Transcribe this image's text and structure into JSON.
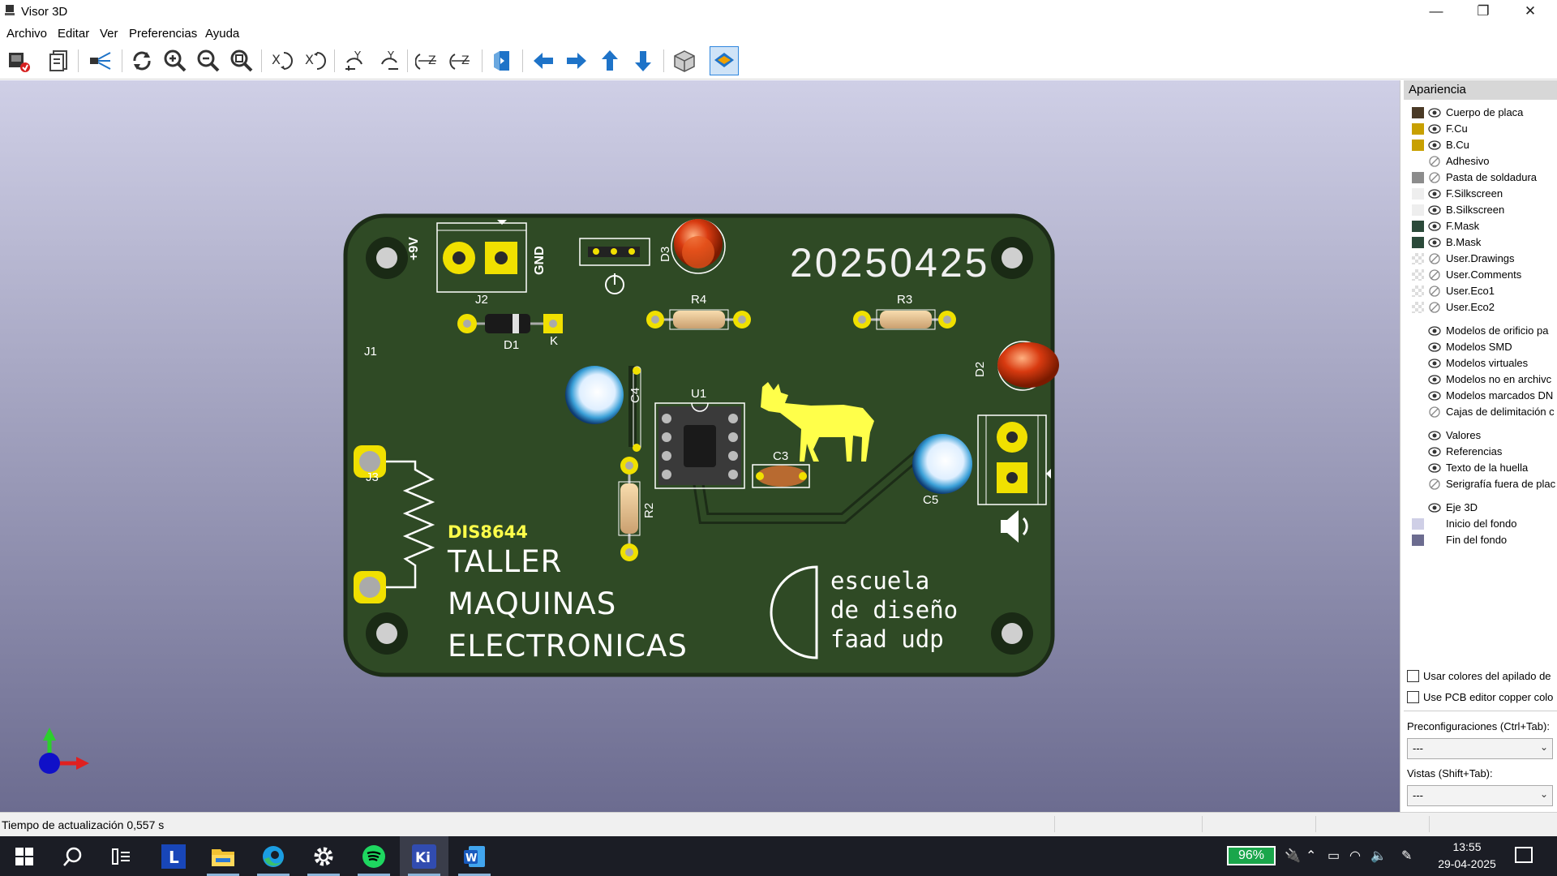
{
  "window": {
    "title": "Visor 3D",
    "minimize": "—",
    "restore": "❐",
    "close": "✕"
  },
  "menu": [
    "Archivo",
    "Editar",
    "Ver",
    "Preferencias",
    "Ayuda"
  ],
  "toolbar": [
    "render-raytrace-icon",
    "copy-image-icon",
    "camera-icon",
    "reload-icon",
    "zoom-in-icon",
    "zoom-out-icon",
    "zoom-fit-icon",
    "rotate-x-cw-icon",
    "rotate-x-ccw-icon",
    "rotate-y-cw-icon",
    "rotate-y-ccw-icon",
    "rotate-z-cw-icon",
    "rotate-z-ccw-icon",
    "flip-board-icon",
    "arrow-left-icon",
    "arrow-right-icon",
    "arrow-up-icon",
    "arrow-down-icon",
    "ortho-view-icon",
    "layers-icon"
  ],
  "board": {
    "silk": {
      "date": "20250425",
      "plus9v": "+9V",
      "gnd": "GND",
      "j2": "J2",
      "d1": "D1",
      "k": "K",
      "d3": "D3",
      "r4": "R4",
      "r3": "R3",
      "j1": "J1",
      "j3": "J3",
      "c4": "C4",
      "u1": "U1",
      "c3": "C3",
      "d2": "D2",
      "c5": "C5",
      "r2": "R2",
      "code": "DIS8644",
      "taller1": "TALLER",
      "taller2": "MAQUINAS",
      "taller3": "ELECTRONICAS",
      "esc1": "escuela",
      "esc2": "de diseño",
      "esc3": "faad udp"
    },
    "colors": {
      "pcb": "#2f4a25",
      "pad": "#f0e000",
      "silk": "#ffffff",
      "deer": "#ffff4a"
    }
  },
  "appearance": {
    "title": "Apariencia",
    "layers": [
      {
        "name": "Cuerpo de placa",
        "color": "#4a3a26",
        "visible": true
      },
      {
        "name": "F.Cu",
        "color": "#c8a000",
        "visible": true
      },
      {
        "name": "B.Cu",
        "color": "#c8a000",
        "visible": true
      },
      {
        "name": "Adhesivo",
        "color": "",
        "visible": false
      },
      {
        "name": "Pasta de soldadura",
        "color": "#8c8c8c",
        "visible": false
      },
      {
        "name": "F.Silkscreen",
        "color": "#eeeeee",
        "visible": true
      },
      {
        "name": "B.Silkscreen",
        "color": "#eeeeee",
        "visible": true
      },
      {
        "name": "F.Mask",
        "color": "#2b4a3a",
        "visible": true
      },
      {
        "name": "B.Mask",
        "color": "#2b4a3a",
        "visible": true
      },
      {
        "name": "User.Drawings",
        "color": "checker",
        "visible": false
      },
      {
        "name": "User.Comments",
        "color": "checker",
        "visible": false
      },
      {
        "name": "User.Eco1",
        "color": "checker",
        "visible": false
      },
      {
        "name": "User.Eco2",
        "color": "checker",
        "visible": false
      }
    ],
    "models": [
      {
        "name": "Modelos de orificio pa",
        "visible": true
      },
      {
        "name": "Modelos SMD",
        "visible": true
      },
      {
        "name": "Modelos virtuales",
        "visible": true
      },
      {
        "name": "Modelos no en archivc",
        "visible": true
      },
      {
        "name": "Modelos marcados DN",
        "visible": true
      },
      {
        "name": "Cajas de delimitación c",
        "visible": false
      }
    ],
    "annotations": [
      {
        "name": "Valores",
        "visible": true
      },
      {
        "name": "Referencias",
        "visible": true
      },
      {
        "name": "Texto de la huella",
        "visible": true
      },
      {
        "name": "Serigrafía fuera de plac",
        "visible": false
      }
    ],
    "axis": {
      "name": "Eje 3D",
      "visible": true
    },
    "background": [
      {
        "name": "Inicio del fondo",
        "color": "#cfcfe6"
      },
      {
        "name": "Fin del fondo",
        "color": "#6c6c90"
      }
    ],
    "check1": "Usar colores del apilado de",
    "check2": "Use PCB editor copper colo",
    "presets_label": "Preconfiguraciones (Ctrl+Tab):",
    "presets_value": "---",
    "views_label": "Vistas (Shift+Tab):",
    "views_value": "---"
  },
  "status": {
    "text": "Tiempo de actualización 0,557 s"
  },
  "taskbar": {
    "apps": [
      "start-icon",
      "search-icon",
      "task-view-icon",
      "app-l-icon",
      "file-explorer-icon",
      "edge-icon",
      "settings-icon",
      "spotify-icon",
      "kicad-icon",
      "word-icon"
    ],
    "battery": "96%",
    "time": "13:55",
    "date": "29-04-2025"
  }
}
